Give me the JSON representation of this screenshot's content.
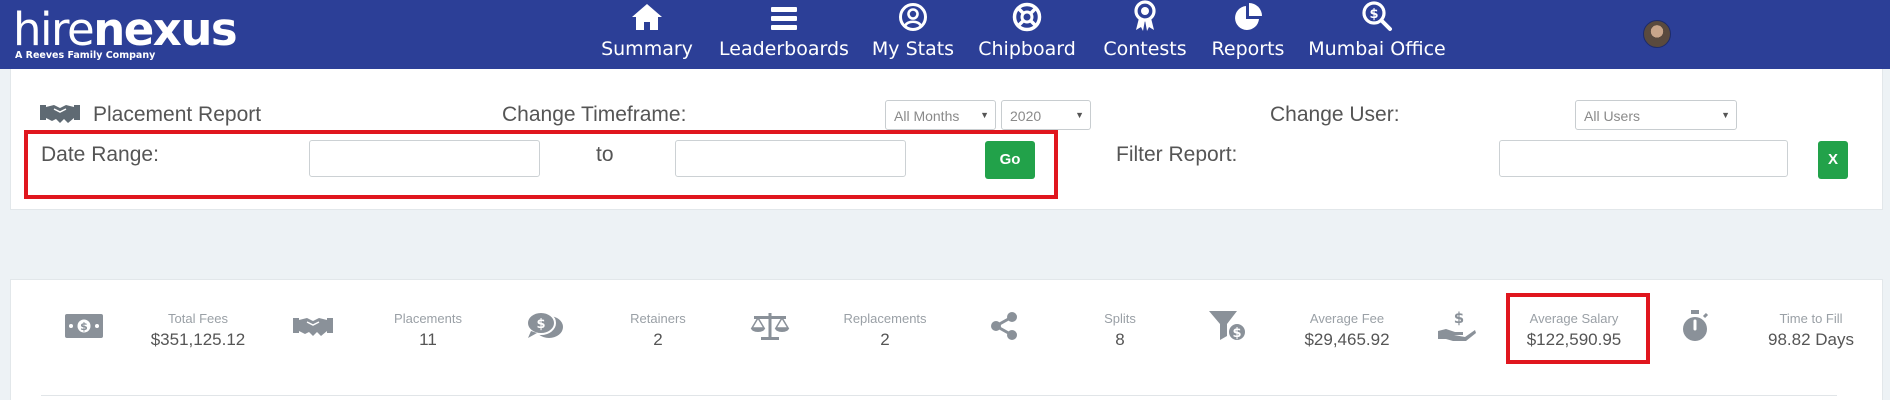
{
  "brand": {
    "logo_text_light": "hire",
    "logo_text_bold": "nexus",
    "tagline": "A Reeves Family Company"
  },
  "nav": {
    "items": [
      {
        "label": "Summary",
        "icon": "home-icon"
      },
      {
        "label": "Leaderboards",
        "icon": "menu-bars-icon"
      },
      {
        "label": "My Stats",
        "icon": "user-circle-icon"
      },
      {
        "label": "Chipboard",
        "icon": "lifebuoy-icon"
      },
      {
        "label": "Contests",
        "icon": "award-icon"
      },
      {
        "label": "Reports",
        "icon": "pie-chart-icon"
      },
      {
        "label": "Mumbai Office",
        "icon": "search-dollar-icon"
      }
    ]
  },
  "filters": {
    "report_title": "Placement Report",
    "change_timeframe_label": "Change Timeframe:",
    "months_select": "All Months",
    "year_select": "2020",
    "change_user_label": "Change User:",
    "users_select": "All Users",
    "date_range_label": "Date Range:",
    "to_label": "to",
    "date_from_value": "",
    "date_to_value": "",
    "go_label": "Go",
    "filter_report_label": "Filter Report:",
    "filter_value": "",
    "clear_label": "X"
  },
  "stats": [
    {
      "label": "Total Fees",
      "value": "$351,125.12",
      "icon": "money-bill-icon"
    },
    {
      "label": "Placements",
      "value": "11",
      "icon": "handshake-icon"
    },
    {
      "label": "Retainers",
      "value": "2",
      "icon": "comments-dollar-icon"
    },
    {
      "label": "Replacements",
      "value": "2",
      "icon": "balance-scale-icon"
    },
    {
      "label": "Splits",
      "value": "8",
      "icon": "share-icon"
    },
    {
      "label": "Average Fee",
      "value": "$29,465.92",
      "icon": "funnel-dollar-icon"
    },
    {
      "label": "Average Salary",
      "value": "$122,590.95",
      "icon": "hand-holding-dollar-icon"
    },
    {
      "label": "Time to Fill",
      "value": "98.82 Days",
      "icon": "stopwatch-icon"
    }
  ],
  "colors": {
    "navbar": "#2c3f97",
    "accent_green": "#22a24a",
    "highlight_red": "#e0161e",
    "icon_gray": "#8a9199"
  }
}
